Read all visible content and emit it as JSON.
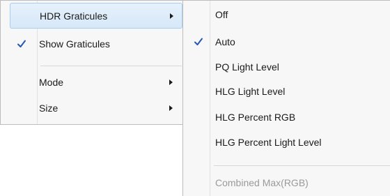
{
  "main_menu": {
    "items": [
      {
        "label": "HDR Graticules",
        "has_submenu": true,
        "checked": false,
        "highlighted": true
      },
      {
        "label": "Show Graticules",
        "has_submenu": false,
        "checked": true,
        "highlighted": false
      },
      {
        "label": "Mode",
        "has_submenu": true,
        "checked": false,
        "highlighted": false
      },
      {
        "label": "Size",
        "has_submenu": true,
        "checked": false,
        "highlighted": false
      }
    ]
  },
  "sub_menu": {
    "items": [
      {
        "label": "Off",
        "checked": false,
        "enabled": true
      },
      {
        "label": "Auto",
        "checked": true,
        "enabled": true
      },
      {
        "label": "PQ Light Level",
        "checked": false,
        "enabled": true
      },
      {
        "label": "HLG Light Level",
        "checked": false,
        "enabled": true
      },
      {
        "label": "HLG Percent RGB",
        "checked": false,
        "enabled": true
      },
      {
        "label": "HLG Percent Light Level",
        "checked": false,
        "enabled": true
      },
      {
        "label": "Combined Max(RGB)",
        "checked": false,
        "enabled": false
      }
    ]
  },
  "colors": {
    "checkmark": "#2456b8",
    "highlight_border": "#a9cdee",
    "disabled_text": "#9a9a9a"
  },
  "icons": {
    "check": "checkmark-icon",
    "submenu": "submenu-arrow-icon"
  }
}
